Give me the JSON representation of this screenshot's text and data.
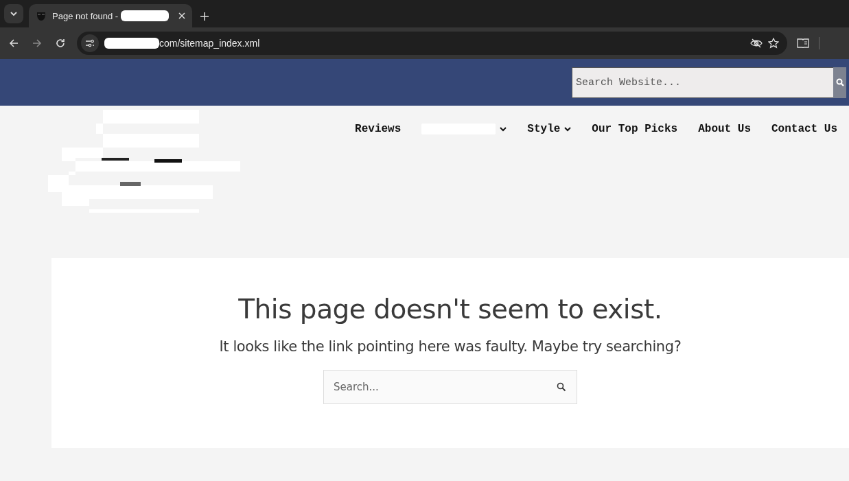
{
  "browser": {
    "tab_title": "Page not found -",
    "url": "com/sitemap_index.xml"
  },
  "header": {
    "search": {
      "placeholder": "Search Website..."
    }
  },
  "nav": [
    {
      "kind": "link",
      "label": "Reviews"
    },
    {
      "kind": "redacted-dropdown"
    },
    {
      "kind": "dropdown",
      "label": "Style"
    },
    {
      "kind": "link",
      "label": "Our Top Picks"
    },
    {
      "kind": "link",
      "label": "About Us"
    },
    {
      "kind": "link",
      "label": "Contact Us"
    }
  ],
  "error": {
    "title": "This page doesn't seem to exist.",
    "message": "It looks like the link pointing here was faulty. Maybe try searching?",
    "search": {
      "placeholder": "Search..."
    }
  }
}
